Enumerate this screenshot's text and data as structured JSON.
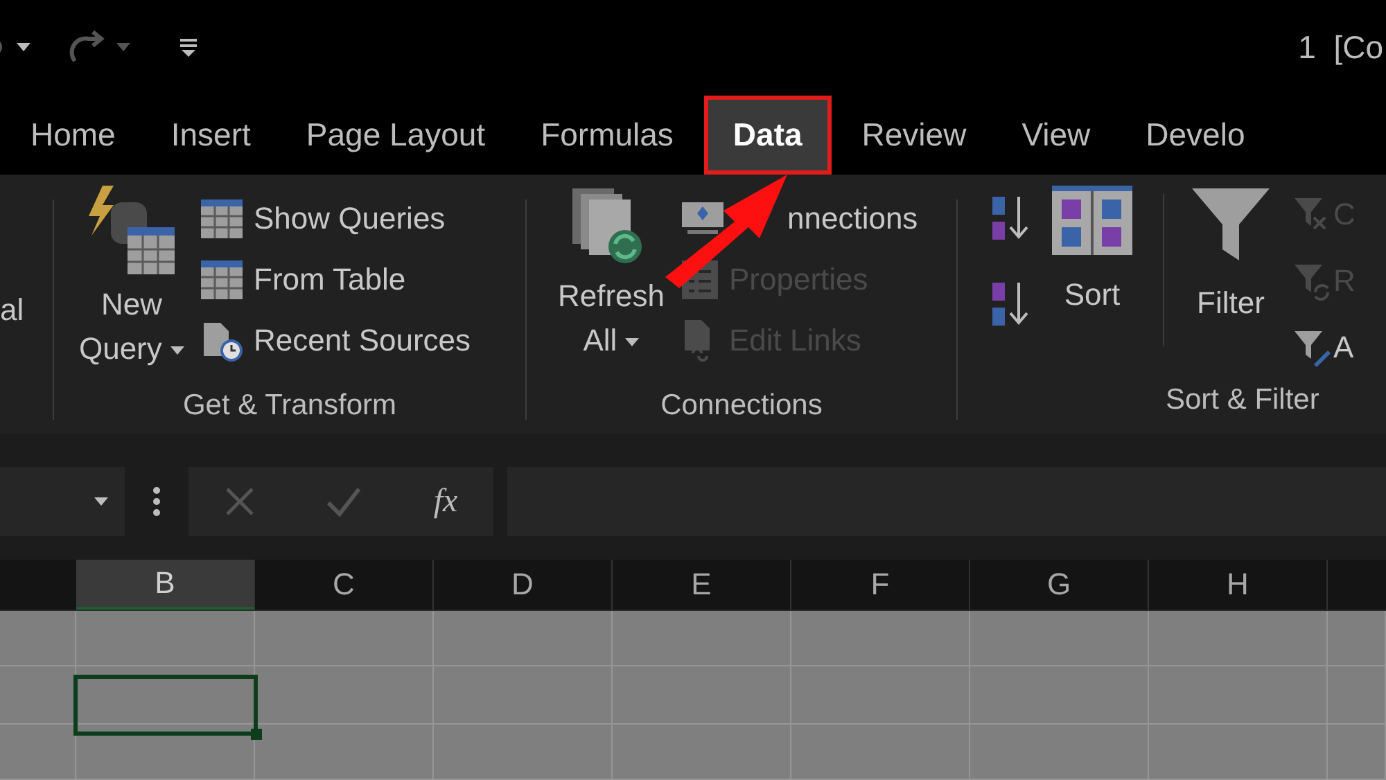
{
  "title_bar": {
    "title": "1  [Co"
  },
  "tabs": [
    {
      "label": "Home",
      "selected": false
    },
    {
      "label": "Insert",
      "selected": false
    },
    {
      "label": "Page Layout",
      "selected": false
    },
    {
      "label": "Formulas",
      "selected": false
    },
    {
      "label": "Data",
      "selected": true
    },
    {
      "label": "Review",
      "selected": false
    },
    {
      "label": "View",
      "selected": false
    },
    {
      "label": "Develo",
      "selected": false
    }
  ],
  "ribbon": {
    "cut_label": "al",
    "get_transform": {
      "title": "Get & Transform",
      "big_button": "New Query",
      "items": [
        {
          "label": "Show Queries",
          "disabled": false
        },
        {
          "label": "From Table",
          "disabled": false
        },
        {
          "label": "Recent Sources",
          "disabled": false
        }
      ]
    },
    "connections": {
      "title": "Connections",
      "big_button": "Refresh All",
      "items": [
        {
          "label": "nnections",
          "disabled": false
        },
        {
          "label": "Properties",
          "disabled": true
        },
        {
          "label": "Edit Links",
          "disabled": true
        }
      ]
    },
    "sort_filter": {
      "title": "Sort & Filter",
      "sort_button": "Sort",
      "filter_button": "Filter",
      "side_items": [
        {
          "label": "C",
          "disabled": true
        },
        {
          "label": "R",
          "disabled": true
        },
        {
          "label": "A",
          "disabled": false
        }
      ]
    }
  },
  "formula_bar": {
    "function_button": "fx"
  },
  "columns": [
    {
      "label": "B",
      "selected": true
    },
    {
      "label": "C",
      "selected": false
    },
    {
      "label": "D",
      "selected": false
    },
    {
      "label": "E",
      "selected": false
    },
    {
      "label": "F",
      "selected": false
    },
    {
      "label": "G",
      "selected": false
    },
    {
      "label": "H",
      "selected": false
    }
  ]
}
